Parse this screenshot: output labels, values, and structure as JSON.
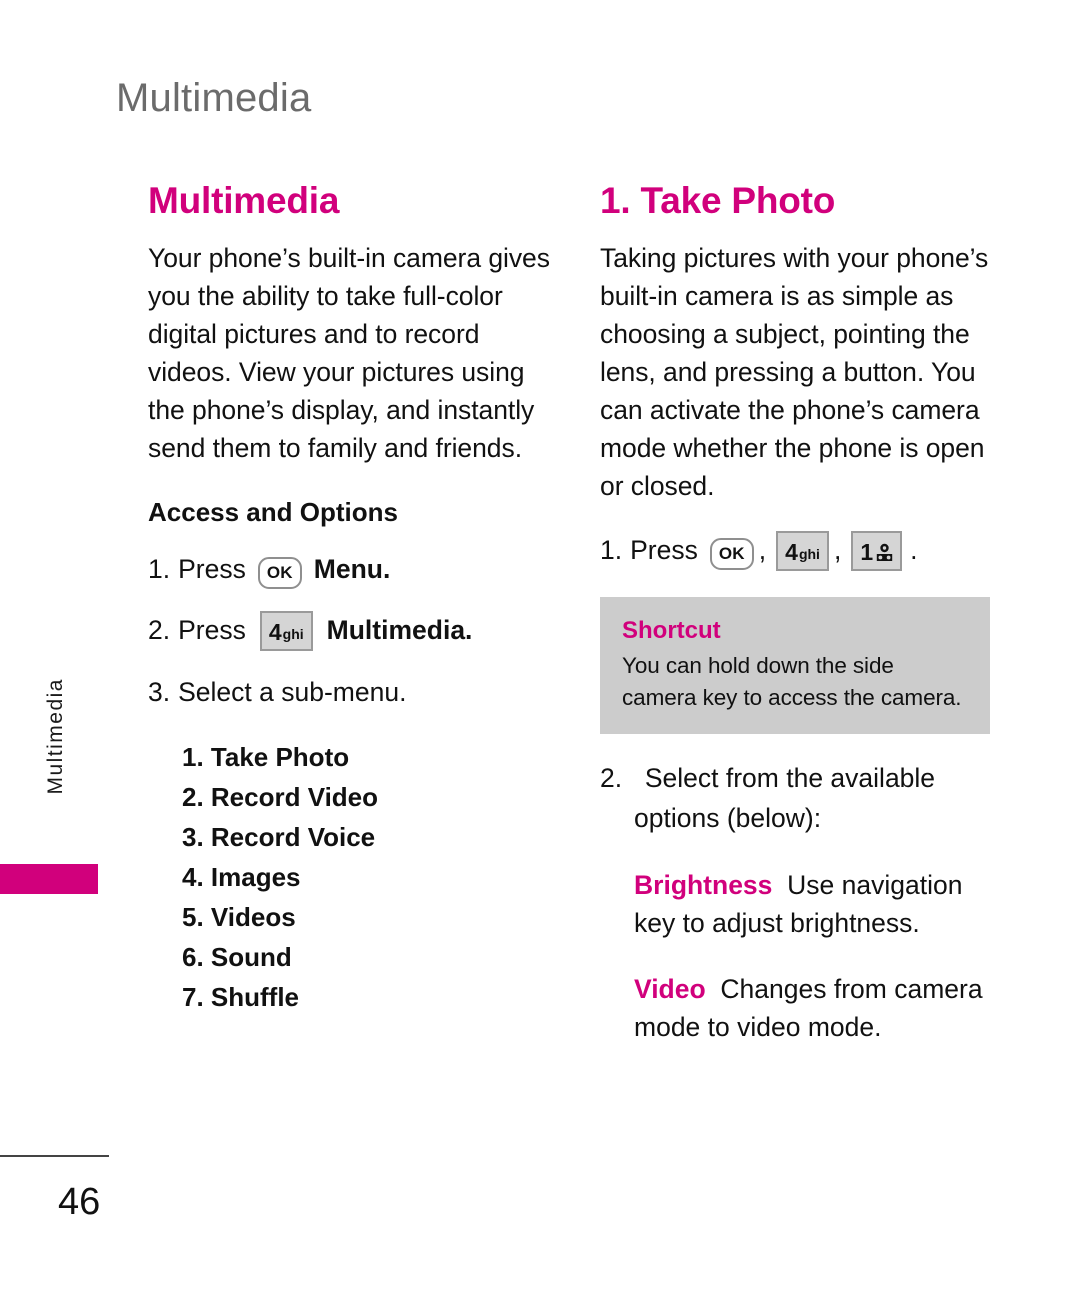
{
  "document": {
    "running_header": "Multimedia",
    "side_tab_label": "Multimedia",
    "page_number": "46"
  },
  "colors": {
    "accent_magenta": "#D1007C",
    "header_gray": "#6b6b6b",
    "callout_bg": "#CCCCCC",
    "key_fill": "#D5D5D5",
    "key_border": "#9A9A9A",
    "text": "#111111"
  },
  "left_column": {
    "title": "Multimedia",
    "intro": "Your phone’s built-in camera gives you the ability to take full-color digital pictures and to record videos. View your pictures using the phone’s display, and instantly send them to family and friends.",
    "subsection_title": "Access and Options",
    "steps": [
      {
        "num": "1.",
        "pre": "Press",
        "key": "OK",
        "key_type": "ok",
        "post": "Menu.",
        "post_bold": true
      },
      {
        "num": "2.",
        "pre": "Press",
        "key_digit": "4",
        "key_letters": "ghi",
        "key_type": "num",
        "post": "Multimedia.",
        "post_bold": true
      },
      {
        "num": "3.",
        "text": "Select a sub-menu."
      }
    ],
    "menu_items": [
      "1. Take Photo",
      "2. Record Video",
      "3. Record Voice",
      "4. Images",
      "5. Videos",
      "6. Sound",
      "7. Shuffle"
    ]
  },
  "right_column": {
    "title": "1. Take Photo",
    "intro": "Taking pictures with your phone’s built-in camera is as simple as choosing a subject, pointing the lens, and pressing a button. You can activate the phone’s camera mode whether the phone is open or closed.",
    "press_step": {
      "num": "1.",
      "pre": "Press",
      "key1": "OK",
      "sep1": ",",
      "key2_digit": "4",
      "key2_letters": "ghi",
      "sep2": ",",
      "key3_digit": "1",
      "key3_icon": "voicemail-icon",
      "end": "."
    },
    "callout": {
      "title": "Shortcut",
      "body": "You can hold down the side camera key to access the camera."
    },
    "select_step": {
      "num": "2.",
      "text": "Select from the available options (below):"
    },
    "options": [
      {
        "term": "Brightness",
        "description": "Use navigation key to adjust brightness."
      },
      {
        "term": "Video",
        "description": "Changes from camera mode to video mode."
      }
    ]
  }
}
